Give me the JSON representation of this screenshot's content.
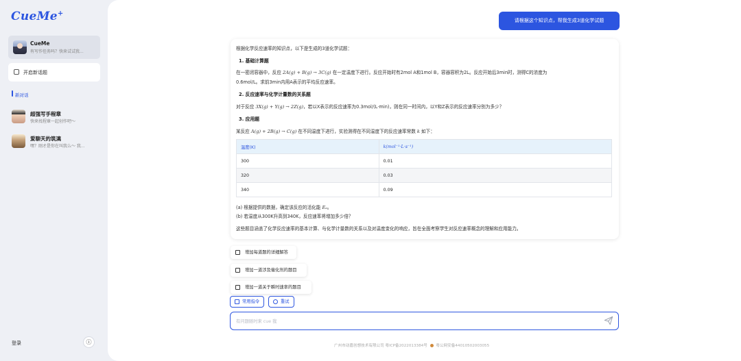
{
  "app": {
    "logo": "CueMe",
    "logo_plus": "+"
  },
  "sidebar": {
    "current": {
      "name": "CueMe",
      "subtitle": "有写作任务吗？快来试试我..."
    },
    "new_chat": "开启新话题",
    "section": "新对话",
    "chats": [
      {
        "title": "超强写手程章",
        "subtitle": "快来找程章一起创作吧～"
      },
      {
        "title": "爱聊天的筑漓",
        "subtitle": "嘿？刚才是你在叫我么～ 我..."
      }
    ],
    "login": "登录",
    "info_icon": "ⓘ"
  },
  "conversation": {
    "user_message": "请根据这个知识点，帮我生成3道化学试题",
    "answer": {
      "intro": "根据化学反应速率的知识点，以下是生成的3道化学试题：",
      "q1_head": "1. 基础计算题",
      "q1_line1_a": "在一密闭容器中，反应 ",
      "q1_eq": "2A(g) + B(g) → 3C(g)",
      "q1_line1_b": " 在一定温度下进行。反应开始时有2mol A和1mol B，容器容积为2L。反应开始后3min时，测得C的浓度为",
      "q1_line2": "0.6mol/L。求前3min内用A表示的平均反应速率。",
      "q2_head": "2. 反应速率与化学计量数的关系题",
      "q2_line_a": "对于反应 ",
      "q2_eq": "3X(g) + Y(g) → 2Z(g)",
      "q2_line_b": "，若以X表示的反应速率为0.3mol/(L·min)，则在同一时间内，以Y和Z表示的反应速率分别为多少？",
      "q3_head": "3. 应用题",
      "q3_line_a": "某反应 ",
      "q3_eq": "A(g) + 2B(g) → C(g)",
      "q3_line_b": " 在不同温度下进行，实验测得在不同温度下的反应速率常数 ",
      "q3_k": "k",
      "q3_line_c": " 如下：",
      "table": {
        "headers": [
          "温度(K)",
          "k(mol⁻¹·L·s⁻¹)"
        ],
        "rows": [
          [
            "300",
            "0.01"
          ],
          [
            "320",
            "0.03"
          ],
          [
            "340",
            "0.09"
          ]
        ]
      },
      "sub_a_1": "(a) 根据提供的数据，确定该反应的活化能 ",
      "sub_a_ea": "Eₐ",
      "sub_a_2": "。",
      "sub_b": "(b) 若温度从300K升高到340K，反应速率将增加多少倍？",
      "summary": "这些题目涵盖了化学反应速率的基本计算、与化学计量数的关系以及对温度变化的响应，旨在全面考察学生对反应速率概念的理解和应用能力。"
    },
    "suggestions": [
      "增加每道题的详细解答",
      "增加一道涉及催化剂的题目",
      "增加一道关于瞬时速率的题目"
    ]
  },
  "toolbar": {
    "common_commands": "常用指令",
    "retry": "重试"
  },
  "input": {
    "placeholder": "有问题随时来 cue 我"
  },
  "footer": {
    "company": "广州市动嘉创想技术有限公司 粤ICP备2022013384号",
    "police": "粤公网安备44010502003055"
  },
  "colors": {
    "accent": "#2c55e0"
  }
}
